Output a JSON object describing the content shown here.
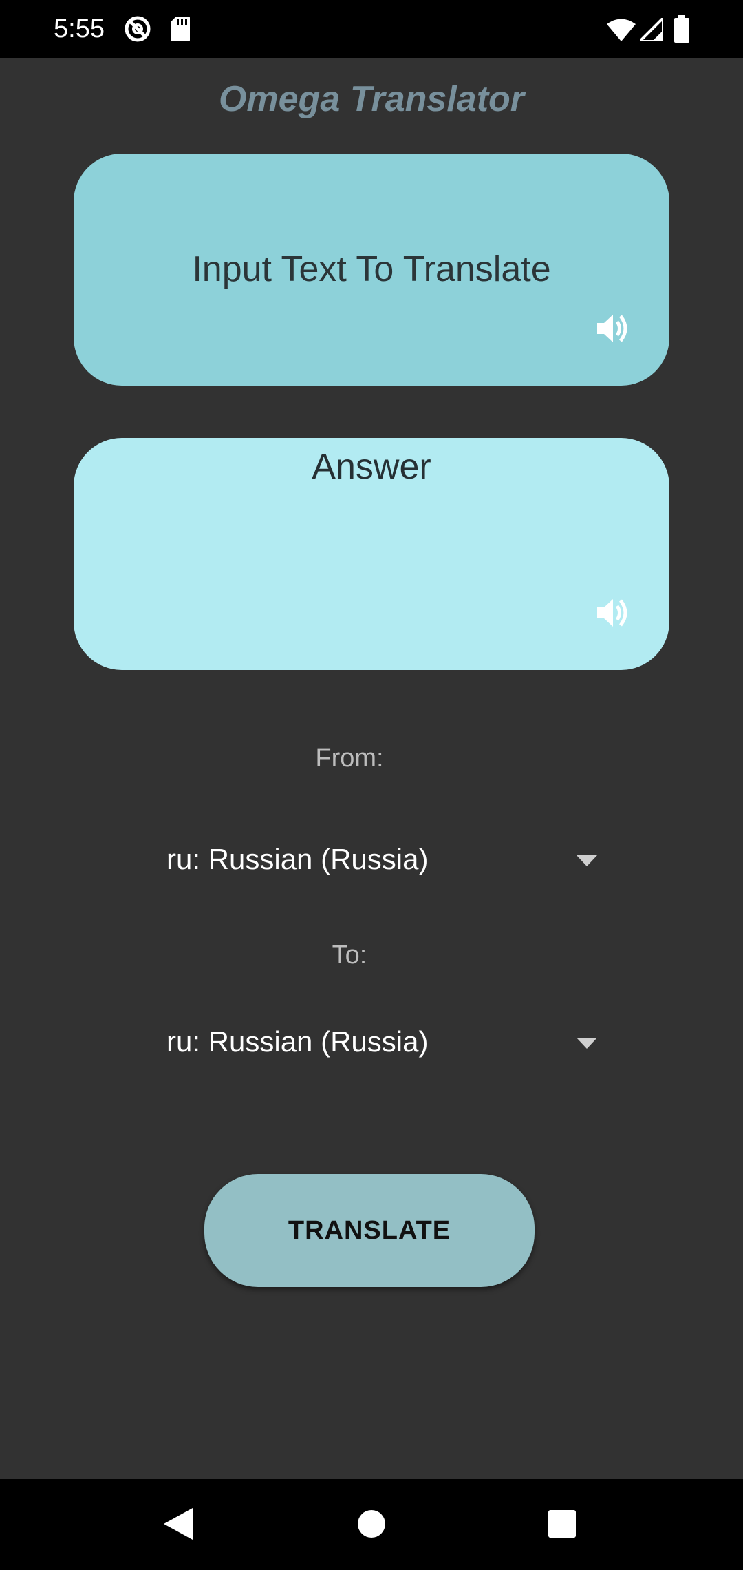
{
  "status_bar": {
    "time": "5:55",
    "icons": [
      "do-not-disturb-icon",
      "sd-card-icon",
      "wifi-icon",
      "cell-signal-icon",
      "battery-icon"
    ]
  },
  "app": {
    "title": "Omega Translator",
    "input_card": {
      "placeholder": "Input Text To Translate",
      "speaker_icon": "volume-icon"
    },
    "answer_card": {
      "text": "Answer",
      "speaker_icon": "volume-icon"
    },
    "from": {
      "label": "From:",
      "selected": "ru: Russian (Russia)"
    },
    "to": {
      "label": "To:",
      "selected": "ru: Russian (Russia)"
    },
    "translate_button": "TRANSLATE"
  },
  "nav_bar": {
    "buttons": [
      "back-icon",
      "home-icon",
      "recents-icon"
    ]
  },
  "colors": {
    "background": "#323232",
    "title": "#78909c",
    "input_card": "#8dd1d9",
    "answer_card": "#b2ebf2",
    "button": "#93bfc5"
  }
}
